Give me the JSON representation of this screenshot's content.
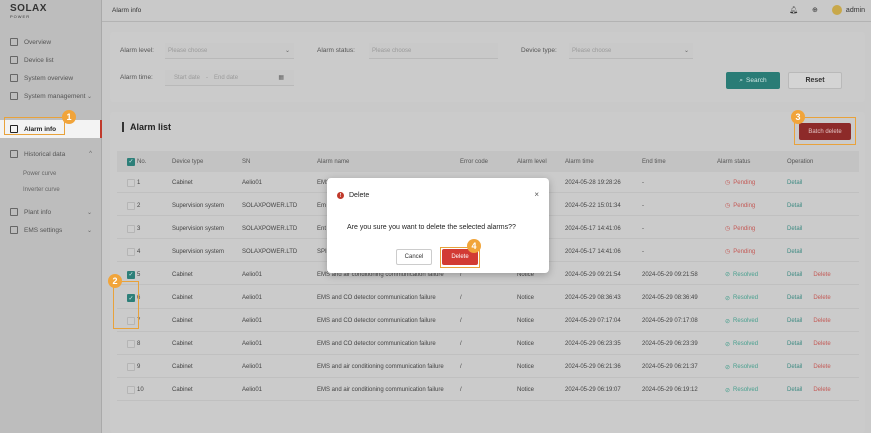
{
  "brand": {
    "name": "SOLAX",
    "sub": "POWER",
    "accent": "#c0392b",
    "primary": "#2a7c76"
  },
  "sidebar": {
    "items": [
      {
        "label": "Overview",
        "icon": "overview-icon"
      },
      {
        "label": "Device list",
        "icon": "device-list-icon"
      },
      {
        "label": "System overview",
        "icon": "system-overview-icon"
      },
      {
        "label": "System management",
        "icon": "system-management-icon",
        "chevron": "⌄"
      },
      {
        "label": "Alarm info",
        "icon": "alarm-icon",
        "active": true
      },
      {
        "label": "Historical data",
        "icon": "history-icon",
        "chevron": "^"
      },
      {
        "label": "Plant info",
        "icon": "plant-icon",
        "chevron": "⌄"
      },
      {
        "label": "EMS settings",
        "icon": "ems-icon",
        "chevron": "⌄"
      }
    ],
    "subitems": [
      "Power curve",
      "Inverter curve"
    ]
  },
  "topbar": {
    "breadcrumb": "Alarm info",
    "user": "admin"
  },
  "filters": {
    "alarm_level_label": "Alarm level:",
    "alarm_level_placeholder": "Please choose",
    "alarm_status_label": "Alarm status:",
    "alarm_status_placeholder": "Please choose",
    "device_type_label": "Device type:",
    "device_type_placeholder": "Please choose",
    "alarm_time_label": "Alarm time:",
    "start_placeholder": "Start date",
    "separator": "-",
    "end_placeholder": "End date",
    "search_label": "Search",
    "reset_label": "Reset"
  },
  "list": {
    "title": "Alarm list",
    "batch_delete": "Batch delete",
    "columns": [
      "No.",
      "Device type",
      "SN",
      "Alarm name",
      "Error code",
      "Alarm level",
      "Alarm time",
      "End time",
      "Alarm status",
      "Operation"
    ],
    "detail": "Detail",
    "delete": "Delete",
    "rows": [
      {
        "no": "1",
        "type": "Cabinet",
        "sn": "Aelio01",
        "name": "EMS",
        "code": "",
        "level": "",
        "time": "2024-05-28 19:28:26",
        "end": "-",
        "status": "Pending",
        "checked": false,
        "deletable": false
      },
      {
        "no": "2",
        "type": "Supervision system",
        "sn": "SOLAXPOWER.LTD",
        "name": "Em",
        "code": "",
        "level": "",
        "time": "2024-05-22 15:01:34",
        "end": "-",
        "status": "Pending",
        "checked": false,
        "deletable": false
      },
      {
        "no": "3",
        "type": "Supervision system",
        "sn": "SOLAXPOWER.LTD",
        "name": "Ent",
        "code": "",
        "level": "",
        "time": "2024-05-17 14:41:06",
        "end": "-",
        "status": "Pending",
        "checked": false,
        "deletable": false
      },
      {
        "no": "4",
        "type": "Supervision system",
        "sn": "SOLAXPOWER.LTD",
        "name": "SPI",
        "code": "",
        "level": "",
        "time": "2024-05-17 14:41:06",
        "end": "-",
        "status": "Pending",
        "checked": false,
        "deletable": false
      },
      {
        "no": "5",
        "type": "Cabinet",
        "sn": "Aelio01",
        "name": "EMS and air conditioning communication failure",
        "code": "/",
        "level": "Notice",
        "time": "2024-05-29 09:21:54",
        "end": "2024-05-29 09:21:58",
        "status": "Resolved",
        "checked": true,
        "deletable": true
      },
      {
        "no": "6",
        "type": "Cabinet",
        "sn": "Aelio01",
        "name": "EMS and CO detector communication failure",
        "code": "/",
        "level": "Notice",
        "time": "2024-05-29 08:36:43",
        "end": "2024-05-29 08:36:49",
        "status": "Resolved",
        "checked": true,
        "deletable": true
      },
      {
        "no": "7",
        "type": "Cabinet",
        "sn": "Aelio01",
        "name": "EMS and CO detector communication failure",
        "code": "/",
        "level": "Notice",
        "time": "2024-05-29 07:17:04",
        "end": "2024-05-29 07:17:08",
        "status": "Resolved",
        "checked": false,
        "deletable": true
      },
      {
        "no": "8",
        "type": "Cabinet",
        "sn": "Aelio01",
        "name": "EMS and CO detector communication failure",
        "code": "/",
        "level": "Notice",
        "time": "2024-05-29 06:23:35",
        "end": "2024-05-29 06:23:39",
        "status": "Resolved",
        "checked": false,
        "deletable": true
      },
      {
        "no": "9",
        "type": "Cabinet",
        "sn": "Aelio01",
        "name": "EMS and air conditioning communication failure",
        "code": "/",
        "level": "Notice",
        "time": "2024-05-29 06:21:36",
        "end": "2024-05-29 06:21:37",
        "status": "Resolved",
        "checked": false,
        "deletable": true
      },
      {
        "no": "10",
        "type": "Cabinet",
        "sn": "Aelio01",
        "name": "EMS and air conditioning communication failure",
        "code": "/",
        "level": "Notice",
        "time": "2024-05-29 06:19:07",
        "end": "2024-05-29 06:19:12",
        "status": "Resolved",
        "checked": false,
        "deletable": true
      }
    ]
  },
  "dialog": {
    "title": "Delete",
    "close": "×",
    "message": "Are you sure you want to delete the selected alarms??",
    "cancel": "Cancel",
    "confirm": "Delete"
  },
  "steps": [
    "1",
    "2",
    "3",
    "4"
  ]
}
